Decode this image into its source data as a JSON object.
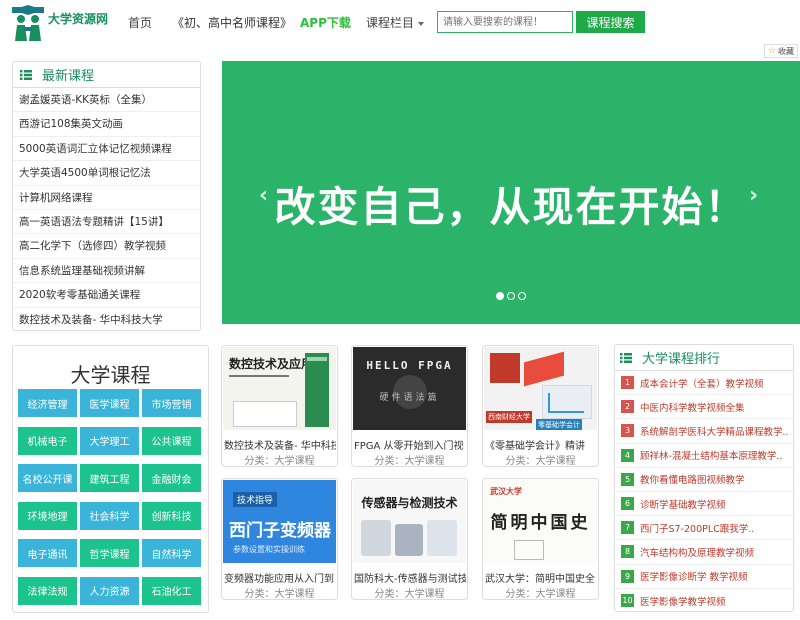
{
  "header": {
    "logo_text": "大学资源网",
    "nav": {
      "home": "首页",
      "famous": "《初、高中名师课程》",
      "app": "APP下载",
      "columns": "课程栏目"
    },
    "search": {
      "placeholder": "请输入要搜索的课程！",
      "button": "课程搜索"
    },
    "favorite": "收藏"
  },
  "latest": {
    "title": "最新课程",
    "items": [
      "谢孟媛英语-KK英标（全集）",
      "西游记108集英文动画",
      "5000英语词汇立体记忆视频课程",
      "大学英语4500单词根记忆法",
      "计算机网络课程",
      "高一英语语法专题精讲【15讲】",
      "高二化学下（选修四）教学视频",
      "信息系统监理基础视频讲解",
      "2020软考零基础通关课程",
      "数控技术及装备- 华中科技大学"
    ]
  },
  "banner": {
    "text": "改变自己，从现在开始！",
    "prev": "‹",
    "next": "›"
  },
  "categories": {
    "title": "大学课程",
    "items": [
      {
        "label": "经济管理",
        "color": "#3ab5d9"
      },
      {
        "label": "医学课程",
        "color": "#3ab5d9"
      },
      {
        "label": "市场营销",
        "color": "#3ab5d9"
      },
      {
        "label": "机械电子",
        "color": "#1dc38c"
      },
      {
        "label": "大学理工",
        "color": "#3ab5d9"
      },
      {
        "label": "公共课程",
        "color": "#1dc38c"
      },
      {
        "label": "名校公开课",
        "color": "#3ab5d9"
      },
      {
        "label": "建筑工程",
        "color": "#1dc38c"
      },
      {
        "label": "金融财会",
        "color": "#1dc38c"
      },
      {
        "label": "环境地理",
        "color": "#1dc38c"
      },
      {
        "label": "社会科学",
        "color": "#3ab5d9"
      },
      {
        "label": "创新科技",
        "color": "#1dc38c"
      },
      {
        "label": "电子通讯",
        "color": "#3ab5d9"
      },
      {
        "label": "哲学课程",
        "color": "#1dc38c"
      },
      {
        "label": "自然科学",
        "color": "#3ab5d9"
      },
      {
        "label": "法律法规",
        "color": "#1dc38c"
      },
      {
        "label": "人力资源",
        "color": "#3ab5d9"
      },
      {
        "label": "石油化工",
        "color": "#1dc38c"
      }
    ]
  },
  "cards": [
    {
      "title": "数控技术及装备- 华中科技",
      "category": "分类：大学课程",
      "thumb_text": "数控技术及应用"
    },
    {
      "title": "FPGA 从零开始到入门视",
      "category": "分类：大学课程",
      "thumb_text": "HELLO FPGA",
      "thumb_sub": "硬件语法篇"
    },
    {
      "title": "《零基础学会计》精讲",
      "category": "分类：大学课程",
      "thumb_text": "零基础学会计",
      "thumb_sub": "西南财经大学"
    },
    {
      "title": "变频器功能应用从入门到",
      "category": "分类：大学课程",
      "thumb_text": "西门子变频器",
      "thumb_sub": "参数设置和实操训练",
      "thumb_tag": "技术指导"
    },
    {
      "title": "国防科大-传感器与测试技",
      "category": "分类：大学课程",
      "thumb_text": "传感器与检测技术"
    },
    {
      "title": "武汉大学：简明中国史全",
      "category": "分类：大学课程",
      "thumb_text": "简明中国史",
      "thumb_sub": "武汉大学"
    }
  ],
  "ranking": {
    "title": "大学课程排行",
    "items": [
      {
        "num": "1",
        "label": "成本会计学（全套）教学视频",
        "color": "#d9534f"
      },
      {
        "num": "2",
        "label": "中医内科学教学视频全集",
        "color": "#d9534f"
      },
      {
        "num": "3",
        "label": "系统解剖学医科大学精品课程教学..",
        "color": "#d9534f"
      },
      {
        "num": "4",
        "label": "顾祥林-混凝土结构基本原理教学..",
        "color": "#3aa84a"
      },
      {
        "num": "5",
        "label": "教你看懂电路图视频教学",
        "color": "#3aa84a"
      },
      {
        "num": "6",
        "label": "诊断学基础教学视频",
        "color": "#3aa84a"
      },
      {
        "num": "7",
        "label": "西门子S7-200PLC跟我学..",
        "color": "#3aa84a"
      },
      {
        "num": "8",
        "label": "汽车结构构及原理教学视频",
        "color": "#3aa84a"
      },
      {
        "num": "9",
        "label": "医学影像诊断学 教学视频",
        "color": "#3aa84a"
      },
      {
        "num": "10",
        "label": "医学影像学教学视频",
        "color": "#3aa84a"
      }
    ]
  }
}
